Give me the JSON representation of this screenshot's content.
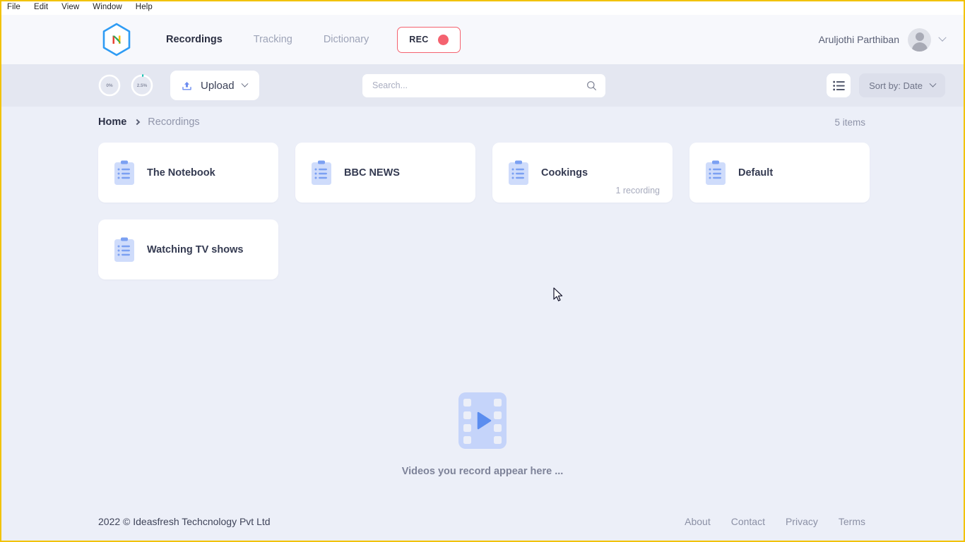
{
  "menubar": {
    "items": [
      {
        "label": "File"
      },
      {
        "label": "Edit"
      },
      {
        "label": "View"
      },
      {
        "label": "Window"
      },
      {
        "label": "Help"
      }
    ]
  },
  "topnav": {
    "logo_icon": "hexagon-n-logo-icon",
    "links": [
      {
        "label": "Recordings",
        "active": true
      },
      {
        "label": "Tracking",
        "active": false
      },
      {
        "label": "Dictionary",
        "active": false
      }
    ],
    "rec_button": {
      "label": "REC",
      "dot_color": "#f4626f",
      "border_color": "#f4626f"
    },
    "user": {
      "name": "Aruljothi Parthiban",
      "avatar_icon": "user-avatar-icon",
      "chevron_icon": "chevron-down-icon"
    }
  },
  "toolbar": {
    "rings": [
      {
        "label": "0%",
        "value": 0,
        "color": "#19c3b2"
      },
      {
        "label": "2.5%",
        "value": 2.5,
        "color": "#19c3b2"
      }
    ],
    "upload": {
      "label": "Upload",
      "icon": "upload-icon",
      "chevron_icon": "chevron-down-icon"
    },
    "search": {
      "placeholder": "Search...",
      "value": "",
      "icon": "search-icon"
    },
    "view_toggle_icon": "list-view-icon",
    "sort": {
      "label": "Sort by: Date",
      "chevron_icon": "chevron-down-icon"
    }
  },
  "content": {
    "breadcrumb": {
      "home": "Home",
      "current": "Recordings"
    },
    "item_count": "5 items",
    "folders": [
      {
        "name": "The Notebook",
        "count": ""
      },
      {
        "name": "BBC NEWS",
        "count": ""
      },
      {
        "name": "Cookings",
        "count": "1 recording"
      },
      {
        "name": "Default",
        "count": ""
      },
      {
        "name": "Watching TV shows",
        "count": ""
      }
    ],
    "empty_state": {
      "icon": "video-film-icon",
      "text": "Videos you record appear here ..."
    }
  },
  "footer": {
    "copyright": "2022 © Ideasfresh Techcnology Pvt Ltd",
    "links": [
      {
        "label": "About"
      },
      {
        "label": "Contact"
      },
      {
        "label": "Privacy"
      },
      {
        "label": "Terms"
      }
    ]
  },
  "colors": {
    "accent_blue": "#5b8def",
    "rec_red": "#f4626f",
    "page_bg": "#eceff8",
    "nav_bg": "#f7f8fc",
    "toolbar_bg": "#e4e7f1"
  }
}
